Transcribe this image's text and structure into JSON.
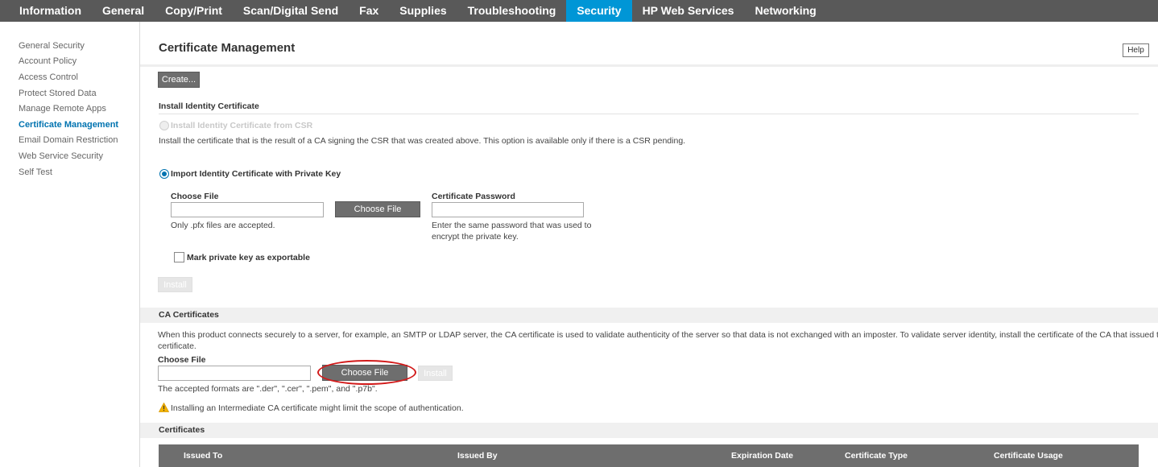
{
  "nav": {
    "tabs": [
      {
        "label": "Information"
      },
      {
        "label": "General"
      },
      {
        "label": "Copy/Print"
      },
      {
        "label": "Scan/Digital Send"
      },
      {
        "label": "Fax"
      },
      {
        "label": "Supplies"
      },
      {
        "label": "Troubleshooting"
      },
      {
        "label": "Security",
        "active": true
      },
      {
        "label": "HP Web Services"
      },
      {
        "label": "Networking"
      }
    ]
  },
  "sidebar": {
    "items": [
      {
        "label": "General Security"
      },
      {
        "label": "Account Policy"
      },
      {
        "label": "Access Control"
      },
      {
        "label": "Protect Stored Data"
      },
      {
        "label": "Manage Remote Apps"
      },
      {
        "label": "Certificate Management",
        "active": true
      },
      {
        "label": "Email Domain Restriction"
      },
      {
        "label": "Web Service Security"
      },
      {
        "label": "Self Test"
      }
    ]
  },
  "page": {
    "title": "Certificate Management",
    "help_label": "Help",
    "create_label": "Create..."
  },
  "identity": {
    "heading": "Install Identity Certificate",
    "csr_option_label": "Install Identity Certificate from CSR",
    "csr_description": "Install the certificate that is the result of a CA signing the CSR that was created above. This option is available only if there is a CSR pending.",
    "import_option_label": "Import Identity Certificate with Private Key",
    "choose_file_label": "Choose File",
    "choose_file_button": "Choose File",
    "file_hint": "Only .pfx files are accepted.",
    "password_label": "Certificate Password",
    "password_hint_line1": "Enter the same password that was used to",
    "password_hint_line2": "encrypt the private key.",
    "exportable_label": "Mark private key as exportable",
    "install_label": "Install"
  },
  "ca": {
    "heading": "CA Certificates",
    "description_line1": "When this product connects securely to a server, for example, an SMTP or LDAP server, the CA certificate is used to validate authenticity of the server so that data is not exchanged with an imposter. To validate server identity, install the certificate of the CA that issued the server",
    "description_line2": "certificate.",
    "choose_file_label": "Choose File",
    "choose_file_button": "Choose File",
    "install_label": "Install",
    "formats_hint": "The accepted formats are \".der\", \".cer\", \".pem\", and \".p7b\".",
    "warning": "Installing an Intermediate CA certificate might limit the scope of authentication."
  },
  "certificates": {
    "heading": "Certificates",
    "columns": [
      "Issued To",
      "Issued By",
      "Expiration Date",
      "Certificate Type",
      "Certificate Usage"
    ]
  },
  "colors": {
    "nav_bg": "#595959",
    "nav_active": "#0096d6",
    "sidebar_active": "#0073b0",
    "button_bg": "#6e6e6e",
    "highlight": "#d21a1a",
    "warning": "#f5b400"
  }
}
